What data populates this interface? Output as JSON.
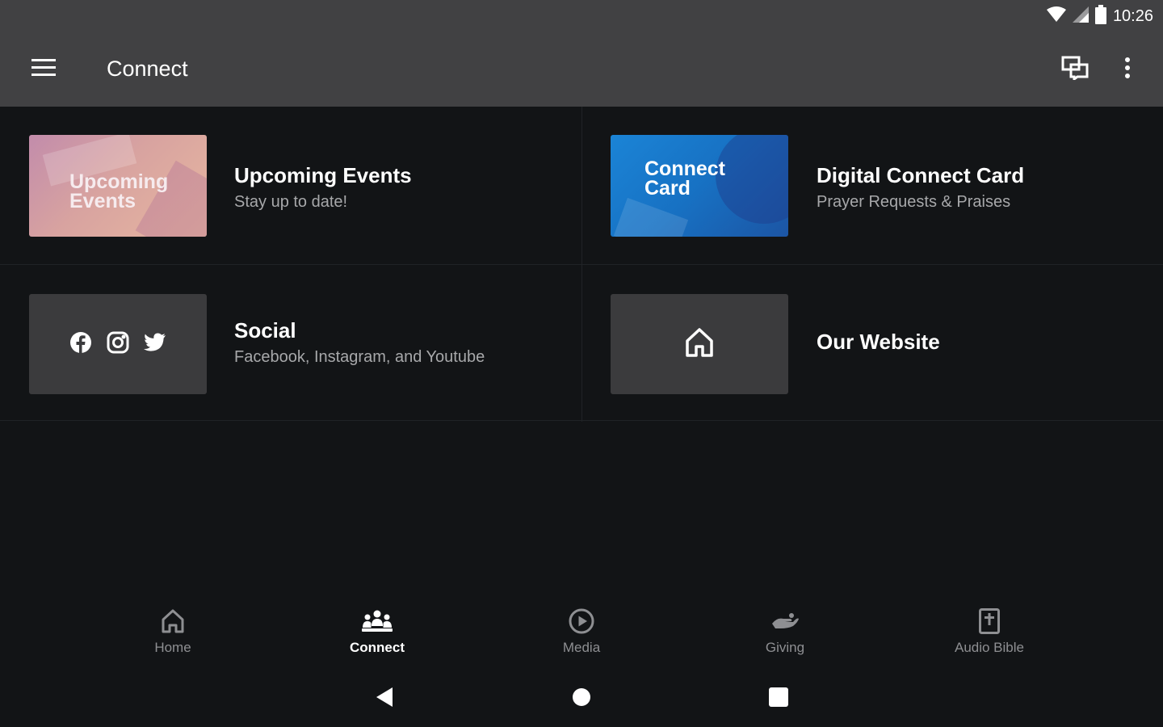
{
  "status_bar": {
    "time": "10:26"
  },
  "app_bar": {
    "title": "Connect"
  },
  "tiles": [
    {
      "title": "Upcoming Events",
      "subtitle": "Stay up to date!",
      "thumb_text": [
        "Upcoming",
        "Events"
      ]
    },
    {
      "title": "Digital Connect Card",
      "subtitle": "Prayer Requests & Praises",
      "thumb_text": [
        "Connect",
        "Card"
      ]
    },
    {
      "title": "Social",
      "subtitle": "Facebook, Instagram, and Youtube",
      "thumb_icons": [
        "facebook-icon",
        "instagram-icon",
        "twitter-icon"
      ]
    },
    {
      "title": "Our Website",
      "subtitle": "",
      "thumb_icons": [
        "home-icon"
      ]
    }
  ],
  "bottom_nav": {
    "active": "Connect",
    "items": [
      {
        "label": "Home",
        "icon": "home-icon"
      },
      {
        "label": "Connect",
        "icon": "people-icon"
      },
      {
        "label": "Media",
        "icon": "play-circle-icon"
      },
      {
        "label": "Giving",
        "icon": "giving-hand-icon"
      },
      {
        "label": "Audio Bible",
        "icon": "bible-icon"
      }
    ]
  },
  "colors": {
    "app_bar": "#414143",
    "background": "#121416",
    "tile_placeholder": "#3b3b3d",
    "subtitle": "#a7a8aa",
    "nav_inactive": "#8e8f92",
    "nav_active": "#ffffff"
  }
}
